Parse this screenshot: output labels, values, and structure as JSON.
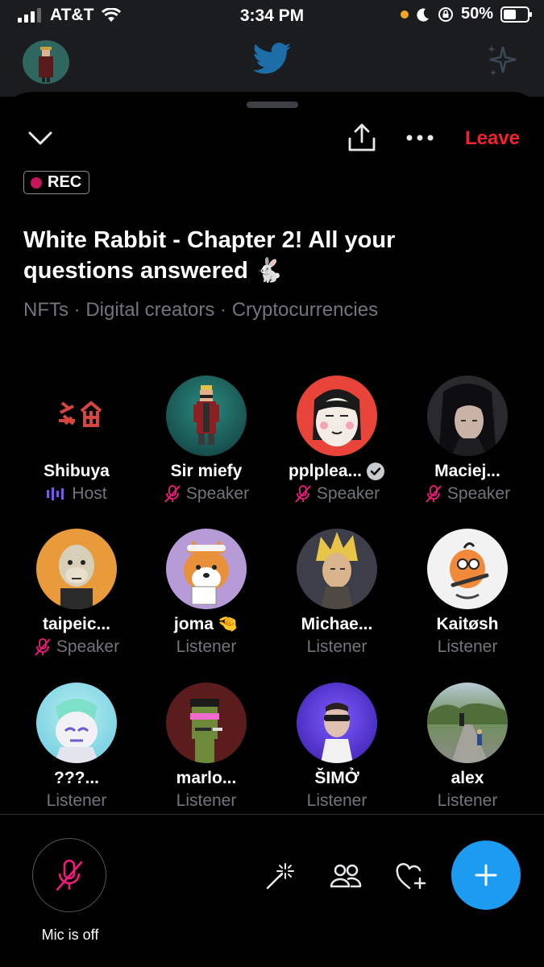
{
  "status_bar": {
    "carrier": "AT&T",
    "time": "3:34 PM",
    "battery": "50%"
  },
  "header": {
    "leave_label": "Leave"
  },
  "space": {
    "rec_label": "REC",
    "title": "White Rabbit - Chapter 2! All your questions answered 🐇",
    "topics": "NFTs · Digital creators · Cryptocurrencies"
  },
  "participants": [
    {
      "name": "Shibuya",
      "role": "Host",
      "verified": false,
      "emoji": "",
      "avatar_color": "#000000",
      "icon": "shibuya-logo"
    },
    {
      "name": "Sir miefy",
      "role": "Speaker",
      "verified": false,
      "emoji": "",
      "avatar_color": "#2f6f6a",
      "icon": "pixel-character"
    },
    {
      "name": "pplplea...",
      "role": "Speaker",
      "verified": true,
      "emoji": "",
      "avatar_color": "#e8443a",
      "icon": "drawn-face"
    },
    {
      "name": "Maciej...",
      "role": "Speaker",
      "verified": false,
      "emoji": "",
      "avatar_color": "#2a2a2e",
      "icon": "anime-girl"
    },
    {
      "name": "taipeic...",
      "role": "Speaker",
      "verified": false,
      "emoji": "",
      "avatar_color": "#e99a3a",
      "icon": "ape"
    },
    {
      "name": "joma",
      "role": "Listener",
      "verified": false,
      "emoji": "🤏",
      "avatar_color": "#b79bd6",
      "icon": "shiba-dog"
    },
    {
      "name": "Michae...",
      "role": "Listener",
      "verified": false,
      "emoji": "",
      "avatar_color": "#3c3f4a",
      "icon": "blond-portrait"
    },
    {
      "name": "Kaitøsh",
      "role": "Listener",
      "verified": false,
      "emoji": "",
      "avatar_color": "#f2f2f2",
      "icon": "cartoon-bird"
    },
    {
      "name": "???...",
      "role": "Listener",
      "verified": false,
      "emoji": "",
      "avatar_color": "#7dd3e6",
      "icon": "cat-character"
    },
    {
      "name": "marlo...",
      "role": "Listener",
      "verified": false,
      "emoji": "",
      "avatar_color": "#5a1c1c",
      "icon": "pixel-punk"
    },
    {
      "name": "ŠIMỞ",
      "role": "Listener",
      "verified": false,
      "emoji": "",
      "avatar_color": "#5b3bd6",
      "icon": "man-sunglasses"
    },
    {
      "name": "alex",
      "role": "Listener",
      "verified": false,
      "emoji": "",
      "avatar_color": "#8aa68a",
      "icon": "street-photo"
    }
  ],
  "bottom_bar": {
    "mic_label": "Mic is off"
  },
  "colors": {
    "accent": "#1d9bf0",
    "leave": "#f4212e",
    "muted": "#f91880",
    "host_wave": "#7856ff",
    "secondary_text": "#71767b"
  }
}
